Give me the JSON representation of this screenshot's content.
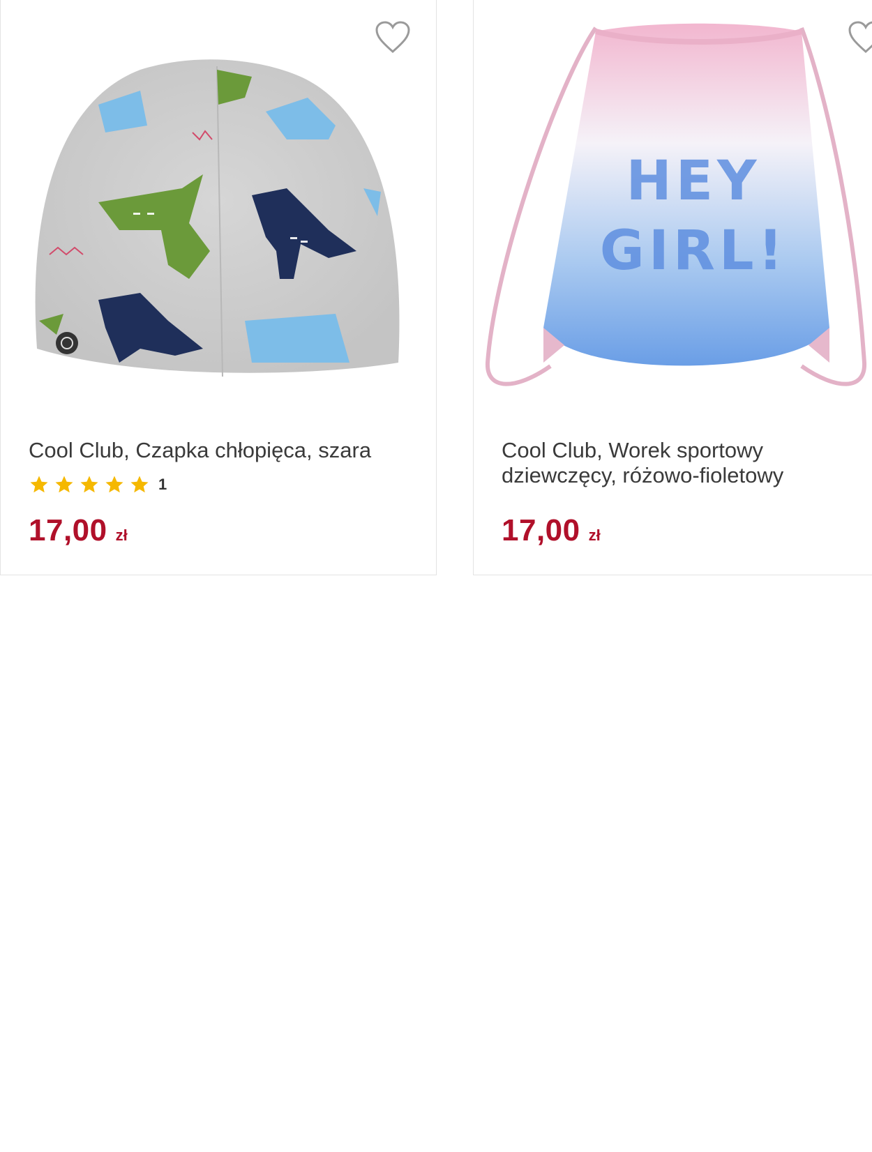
{
  "products": [
    {
      "title": "Cool Club, Czapka chłopięca, szara",
      "rating_count": "1",
      "stars": 5,
      "price": "17,00",
      "currency": "zł",
      "image_icon": "dinosaur-beanie-image"
    },
    {
      "title": "Cool Club, Worek sportowy dziewczęcy, różowo-fioletowy",
      "price": "17,00",
      "currency": "zł",
      "image_icon": "drawstring-bag-image",
      "bag_print": "HEY GIRL!"
    }
  ],
  "colors": {
    "price": "#b0102a",
    "star": "#f5b800",
    "border": "#e3e3e3"
  }
}
